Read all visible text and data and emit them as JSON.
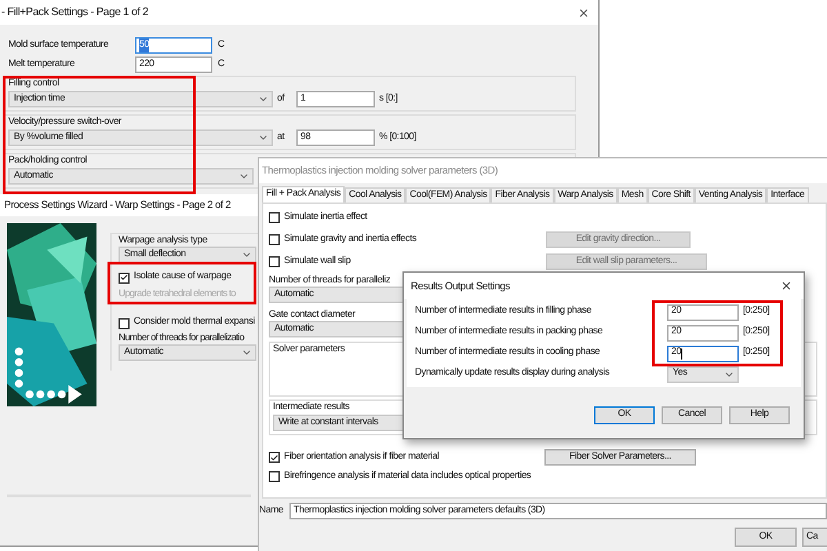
{
  "fill_pack_window": {
    "title": "- Fill+Pack Settings - Page 1 of 2",
    "temperatures": [
      {
        "label": "Mold surface temperature",
        "value": "50",
        "unit": "C",
        "text_selected": true
      },
      {
        "label": "Melt temperature",
        "value": "220",
        "unit": "C",
        "text_selected": false
      }
    ],
    "controls": [
      {
        "label": "Filling control",
        "value": "Injection time",
        "connector": "of",
        "input": "1",
        "unit": "s [0:]"
      },
      {
        "label": "Velocity/pressure switch-over",
        "value": "By %volume filled",
        "connector": "at",
        "input": "98",
        "unit": "% [0:100]"
      },
      {
        "label": "Pack/holding control",
        "value": "Automatic"
      }
    ]
  },
  "warp_window": {
    "title": "Process Settings Wizard - Warp Settings - Page 2 of 2",
    "analysis_type_label": "Warpage analysis type",
    "analysis_type": "Small deflection",
    "options": [
      {
        "kind": "checkbox",
        "label": "Isolate cause of warpage",
        "checked": true
      },
      {
        "kind": "text",
        "label": "Upgrade tetrahedral elements to",
        "disabled": true
      },
      {
        "kind": "checkbox",
        "label": "Consider mold thermal expansi",
        "checked": false
      }
    ],
    "threads_label": "Number of threads for parallelizatio",
    "threads": "Automatic"
  },
  "solver_window": {
    "title": "Thermoplastics injection molding solver parameters (3D)",
    "tabs": [
      {
        "label": "Fill + Pack Analysis",
        "selected": true
      },
      {
        "label": "Cool Analysis",
        "selected": false
      },
      {
        "label": "Cool(FEM) Analysis",
        "selected": false
      },
      {
        "label": "Fiber Analysis",
        "selected": false
      },
      {
        "label": "Warp Analysis",
        "selected": false
      },
      {
        "label": "Mesh",
        "selected": false
      },
      {
        "label": "Core Shift",
        "selected": false
      },
      {
        "label": "Venting Analysis",
        "selected": false
      },
      {
        "label": "Interface",
        "selected": false
      }
    ],
    "options": [
      {
        "label": "Simulate inertia effect",
        "checked": false
      },
      {
        "label": "Simulate gravity and inertia effects",
        "checked": false,
        "button": {
          "label": "Edit gravity direction...",
          "disabled": true
        }
      },
      {
        "label": "Simulate wall slip",
        "checked": false,
        "button": {
          "label": "Edit wall slip parameters...",
          "disabled": true
        }
      }
    ],
    "threads_label": "Number of threads for paralleliz",
    "threads": "Automatic",
    "gate_label": "Gate contact diameter",
    "gate": "Automatic",
    "solver_group": "Solver parameters",
    "intermediate_label": "Intermediate results",
    "intermediate": "Write at constant intervals",
    "bottom_options": [
      {
        "label": "Fiber orientation analysis if fiber material",
        "checked": true,
        "button": {
          "label": "Fiber Solver Parameters...",
          "disabled": false
        }
      },
      {
        "label": "Birefringence analysis if material data includes optical properties",
        "checked": false
      }
    ],
    "name_label": "Name",
    "name": "Thermoplastics injection molding solver parameters defaults (3D)",
    "buttons": [
      "OK",
      "Ca"
    ]
  },
  "results_dialog": {
    "title": "Results Output Settings",
    "rows": [
      {
        "label": "Number of intermediate results in filling phase",
        "value": "20",
        "range": "[0:250]",
        "focused": false
      },
      {
        "label": "Number of intermediate results in packing phase",
        "value": "20",
        "range": "[0:250]",
        "focused": false
      },
      {
        "label": "Number of intermediate results in cooling phase",
        "value": "20",
        "range": "[0:250]",
        "focused": true
      }
    ],
    "dynamic_label": "Dynamically update results display during analysis",
    "dynamic": "Yes",
    "buttons": [
      {
        "label": "OK",
        "default": true
      },
      {
        "label": "Cancel",
        "default": false
      },
      {
        "label": "Help",
        "default": false
      }
    ]
  }
}
